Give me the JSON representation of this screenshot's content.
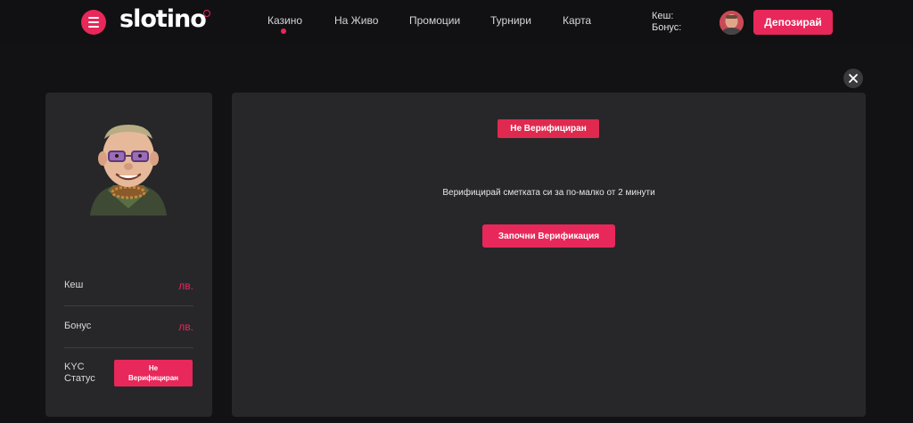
{
  "header": {
    "logo_text": "slotino",
    "nav": [
      {
        "label": "Казино",
        "active": true
      },
      {
        "label": "На Живо"
      },
      {
        "label": "Промоции"
      },
      {
        "label": "Турнири"
      },
      {
        "label": "Карта"
      }
    ],
    "balance_cash_label": "Кеш:",
    "balance_bonus_label": "Бонус:",
    "deposit_label": "Депозирай"
  },
  "profile": {
    "rows": [
      {
        "label": "Кеш",
        "value": "лв."
      },
      {
        "label": "Бонус",
        "value": "лв."
      }
    ],
    "kyc_label_line1": "KYC",
    "kyc_label_line2": "Статус",
    "kyc_status": "Не Верифициран"
  },
  "main": {
    "status_badge": "Не Верифициран",
    "message": "Верифицирай сметката си за по-малко от 2 минути",
    "start_button": "Започни Верификация"
  },
  "colors": {
    "accent": "#e8275a",
    "panel": "#27272a",
    "background": "#121214"
  },
  "icons": {
    "menu": "menu-icon",
    "close": "close-icon",
    "avatar": "avatar-icon"
  }
}
